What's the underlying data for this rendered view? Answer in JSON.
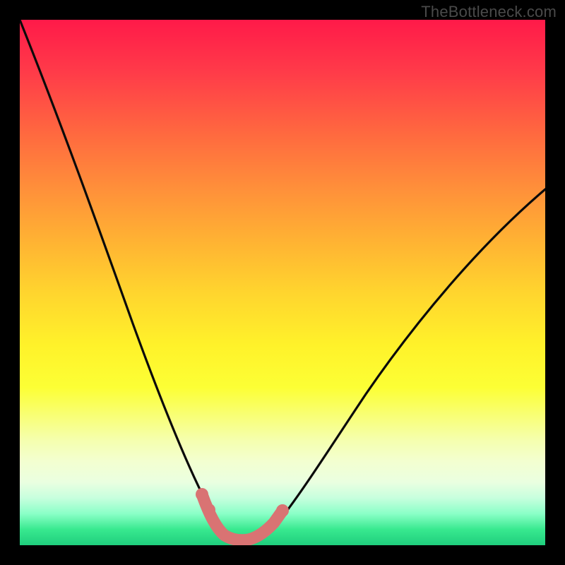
{
  "watermark": "TheBottleneck.com",
  "colors": {
    "frame": "#000000",
    "curve_stroke": "#0a0a0a",
    "highlight_stroke": "#d97373"
  },
  "chart_data": {
    "type": "line",
    "title": "",
    "xlabel": "",
    "ylabel": "",
    "xlim": [
      0,
      100
    ],
    "ylim": [
      0,
      100
    ],
    "grid": false,
    "legend": false,
    "series": [
      {
        "name": "bottleneck-curve",
        "x": [
          0,
          5,
          10,
          15,
          20,
          25,
          28,
          30,
          32,
          34,
          36,
          38,
          40,
          42,
          44,
          46,
          48,
          50,
          55,
          60,
          65,
          70,
          75,
          80,
          85,
          90,
          95,
          100
        ],
        "y": [
          100,
          90,
          79,
          67,
          54,
          40,
          31,
          25,
          19,
          13,
          8,
          4,
          2,
          1,
          1,
          2,
          4,
          7,
          14,
          21,
          27,
          33,
          39,
          44,
          49,
          54,
          58,
          62
        ]
      }
    ],
    "highlight": {
      "description": "flat minimum segment",
      "x": [
        34,
        36,
        38,
        40,
        42,
        44,
        46,
        48
      ],
      "y": [
        13,
        8,
        4,
        2,
        1,
        1,
        2,
        4
      ]
    }
  }
}
